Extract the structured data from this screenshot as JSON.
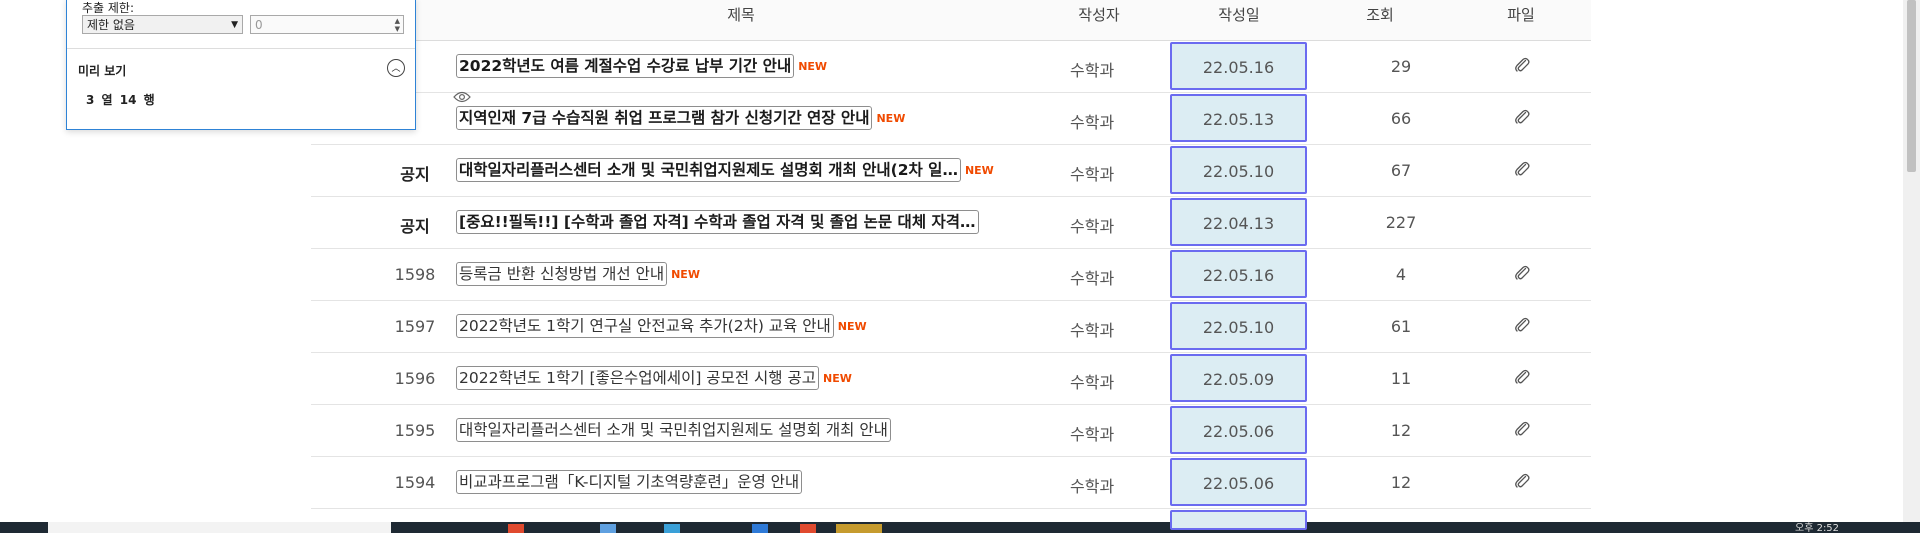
{
  "panel": {
    "limit_label": "추출 제한:",
    "limit_select": "제한 없음",
    "limit_input_value": "0",
    "preview_title": "미리 보기",
    "dims": "3 열 14 행"
  },
  "table": {
    "headers": {
      "title": "제목",
      "author": "작성자",
      "date": "작성일",
      "views": "조회",
      "file": "파일"
    },
    "rows": [
      {
        "num": "",
        "notice": true,
        "title": "2022학년도 여름 계절수업 수강료 납부 기간 안내",
        "new": "NEW",
        "author": "수학과",
        "date": "22.05.16",
        "views": "29",
        "file": true
      },
      {
        "num": "",
        "notice": true,
        "title": "지역인재 7급 수습직원 취업 프로그램 참가 신청기간 연장 안내",
        "new": "NEW",
        "author": "수학과",
        "date": "22.05.13",
        "views": "66",
        "file": true
      },
      {
        "num": "공지",
        "notice": true,
        "title": "대학일자리플러스센터 소개 및 국민취업지원제도 설명회 개최 안내(2차 일…",
        "new": "NEW",
        "author": "수학과",
        "date": "22.05.10",
        "views": "67",
        "file": true
      },
      {
        "num": "공지",
        "notice": true,
        "title": "[중요!!필독!!] [수학과 졸업 자격] 수학과 졸업 자격 및 졸업 논문 대체 자격…",
        "new": "",
        "author": "수학과",
        "date": "22.04.13",
        "views": "227",
        "file": false
      },
      {
        "num": "1598",
        "notice": false,
        "title": "등록금 반환 신청방법 개선 안내",
        "new": "NEW",
        "author": "수학과",
        "date": "22.05.16",
        "views": "4",
        "file": true
      },
      {
        "num": "1597",
        "notice": false,
        "title": "2022학년도 1학기 연구실 안전교육 추가(2차) 교육 안내",
        "new": "NEW",
        "author": "수학과",
        "date": "22.05.10",
        "views": "61",
        "file": true
      },
      {
        "num": "1596",
        "notice": false,
        "title": "2022학년도 1학기 [좋은수업에세이] 공모전 시행 공고",
        "new": "NEW",
        "author": "수학과",
        "date": "22.05.09",
        "views": "11",
        "file": true
      },
      {
        "num": "1595",
        "notice": false,
        "title": "대학일자리플러스센터 소개 및 국민취업지원제도 설명회 개최 안내",
        "new": "",
        "author": "수학과",
        "date": "22.05.06",
        "views": "12",
        "file": true
      },
      {
        "num": "1594",
        "notice": false,
        "title": "비교과프로그램「K-디지털 기초역량훈련」운영 안내",
        "new": "",
        "author": "수학과",
        "date": "22.05.06",
        "views": "12",
        "file": true
      }
    ]
  },
  "taskbar": {
    "clock": "오후 2:52"
  },
  "colors": {
    "accent_outline": "#6b6bf0",
    "date_fill": "#dcedf3",
    "new_badge": "#f04a00",
    "taskbar": "#1e2933"
  },
  "icons": [
    "paperclip-icon",
    "eye-icon",
    "chevron-up-icon",
    "dropdown-arrow-icon"
  ]
}
